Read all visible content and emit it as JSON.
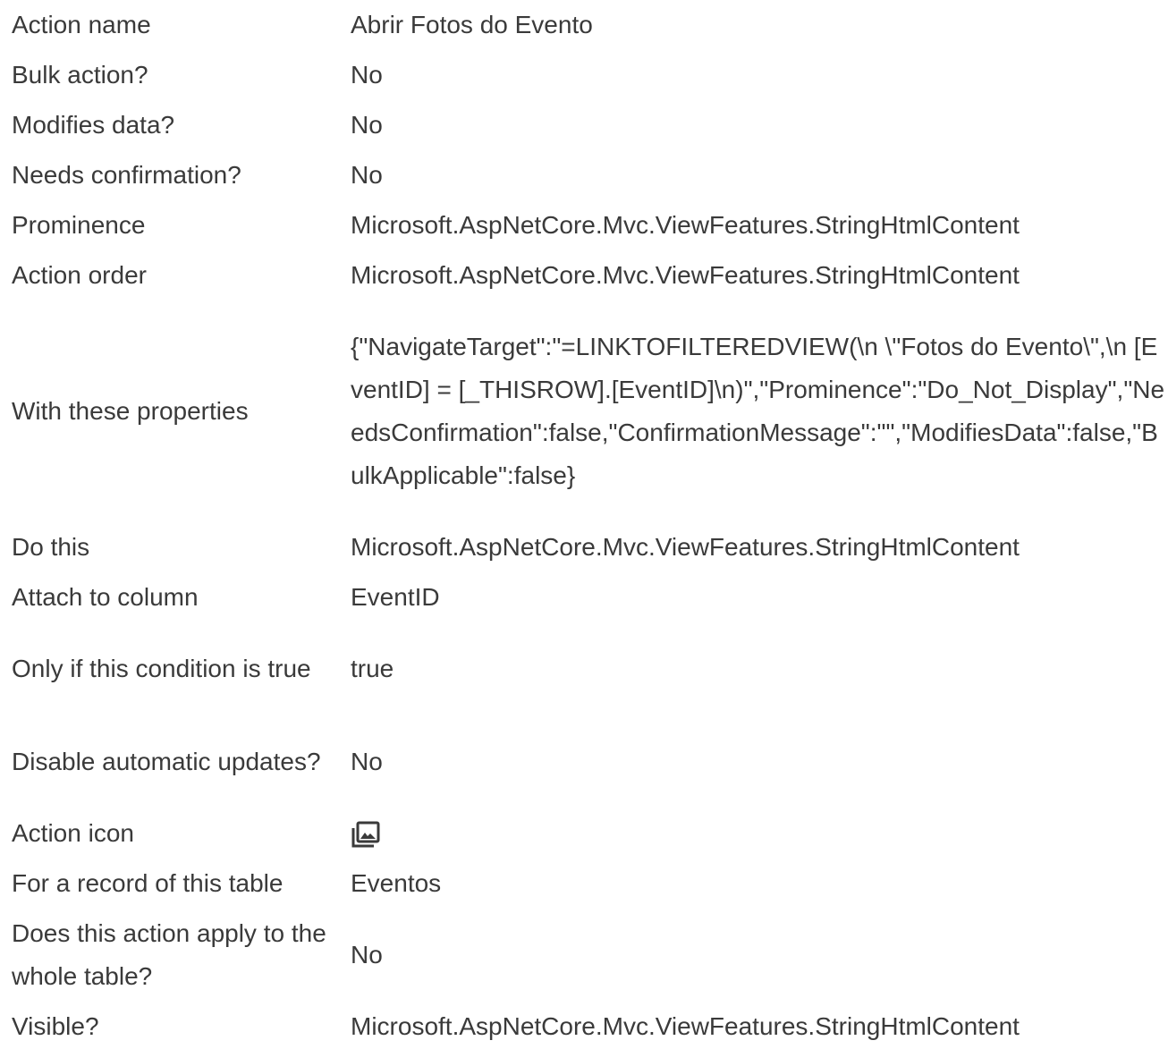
{
  "rows": [
    {
      "label": "Action name",
      "value": "Abrir Fotos do Evento"
    },
    {
      "label": "Bulk action?",
      "value": "No"
    },
    {
      "label": "Modifies data?",
      "value": "No"
    },
    {
      "label": "Needs confirmation?",
      "value": "No"
    },
    {
      "label": "Prominence",
      "value": "Microsoft.AspNetCore.Mvc.ViewFeatures.StringHtmlContent"
    },
    {
      "label": "Action order",
      "value": "Microsoft.AspNetCore.Mvc.ViewFeatures.StringHtmlContent"
    },
    {
      "label": "With these properties",
      "value": "{\"NavigateTarget\":\"=LINKTOFILTEREDVIEW(\\n \\\"Fotos do Evento\\\",\\n [EventID] = [_THISROW].[EventID]\\n)\",\"Prominence\":\"Do_Not_Display\",\"NeedsConfirmation\":false,\"ConfirmationMessage\":\"\",\"ModifiesData\":false,\"BulkApplicable\":false}"
    },
    {
      "label": "Do this",
      "value": "Microsoft.AspNetCore.Mvc.ViewFeatures.StringHtmlContent"
    },
    {
      "label": "Attach to column",
      "value": "EventID"
    },
    {
      "label": "Only if this condition is true",
      "value": "true"
    },
    {
      "label": "Disable automatic updates?",
      "value": "No"
    },
    {
      "label": "Action icon",
      "value_icon": "photo-library-icon"
    },
    {
      "label": "For a record of this table",
      "value": "Eventos"
    },
    {
      "label": "Does this action apply to the whole table?",
      "value": "No"
    },
    {
      "label": "Visible?",
      "value": "Microsoft.AspNetCore.Mvc.ViewFeatures.StringHtmlContent"
    }
  ]
}
